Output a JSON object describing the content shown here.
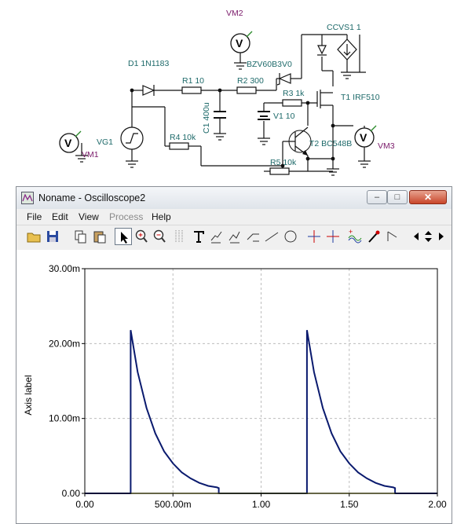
{
  "schematic": {
    "labels": {
      "vm2": "VM2",
      "ccvs1": "CCVS1 1",
      "d1": "D1 1N1183",
      "zener": "BZV60B3V0",
      "r1": "R1 10",
      "r2": "R2 300",
      "r3": "R3 1k",
      "t1": "T1 IRF510",
      "c1": "C1 400u",
      "v1": "V1 10",
      "vg1": "VG1",
      "vm1": "VM1",
      "r4": "R4 10k",
      "t2": "T2 BC548B",
      "vm3": "VM3",
      "r5": "R5 10k",
      "meter_symbol": "V"
    }
  },
  "window": {
    "title": "Noname - Oscilloscope2",
    "controls": {
      "minimize": "–",
      "maximize": "□",
      "close": "✕"
    },
    "menu": [
      "File",
      "Edit",
      "View",
      "Process",
      "Help"
    ],
    "menu_disabled": [
      "Process"
    ],
    "toolbar_icons": [
      "open-folder-icon",
      "save-icon",
      "copy-icon",
      "paste-icon",
      "pointer-icon",
      "zoom-in-icon",
      "zoom-out-icon",
      "grid-icon",
      "text-icon",
      "cursor-annotate-icon",
      "cursor-annotate-2-icon",
      "ramp-icon",
      "line-icon",
      "circle-icon",
      "cursor-a-icon",
      "cursor-b-icon",
      "add-trace-icon",
      "probe-icon",
      "step-icon",
      "scroll-left-icon",
      "scroll-updown-icon",
      "scroll-right-icon"
    ]
  },
  "chart_data": {
    "type": "line",
    "title": "",
    "xlabel": "",
    "ylabel": "Axis label",
    "xlim": [
      0,
      2
    ],
    "ylim": [
      0,
      0.03
    ],
    "x_ticks": [
      "0.00",
      "500.00m",
      "1.00",
      "1.50",
      "2.00"
    ],
    "y_ticks": [
      "0.00",
      "10.00m",
      "20.00m",
      "30.00m"
    ],
    "grid": true,
    "series": [
      {
        "color": "#0a1a6e",
        "x": [
          0.0,
          0.26,
          0.26,
          0.3,
          0.35,
          0.4,
          0.45,
          0.5,
          0.55,
          0.6,
          0.65,
          0.7,
          0.75,
          0.76,
          0.76,
          1.25,
          1.26,
          1.26,
          1.3,
          1.35,
          1.4,
          1.45,
          1.5,
          1.55,
          1.6,
          1.65,
          1.7,
          1.75,
          1.76,
          1.76,
          2.0
        ],
        "y": [
          0.0,
          0.0,
          0.0218,
          0.0162,
          0.0114,
          0.008,
          0.0056,
          0.004,
          0.0028,
          0.002,
          0.0014,
          0.001,
          0.0008,
          0.0007,
          0.0,
          0.0,
          0.0,
          0.0218,
          0.0162,
          0.0114,
          0.008,
          0.0056,
          0.004,
          0.0028,
          0.002,
          0.0014,
          0.001,
          0.0008,
          0.0007,
          0.0,
          0.0
        ]
      },
      {
        "color": "#9a9a1a",
        "x": [
          0.26,
          0.76,
          1.26,
          1.76
        ],
        "y": [
          0.0,
          0.0,
          0.0,
          0.0
        ]
      }
    ]
  }
}
